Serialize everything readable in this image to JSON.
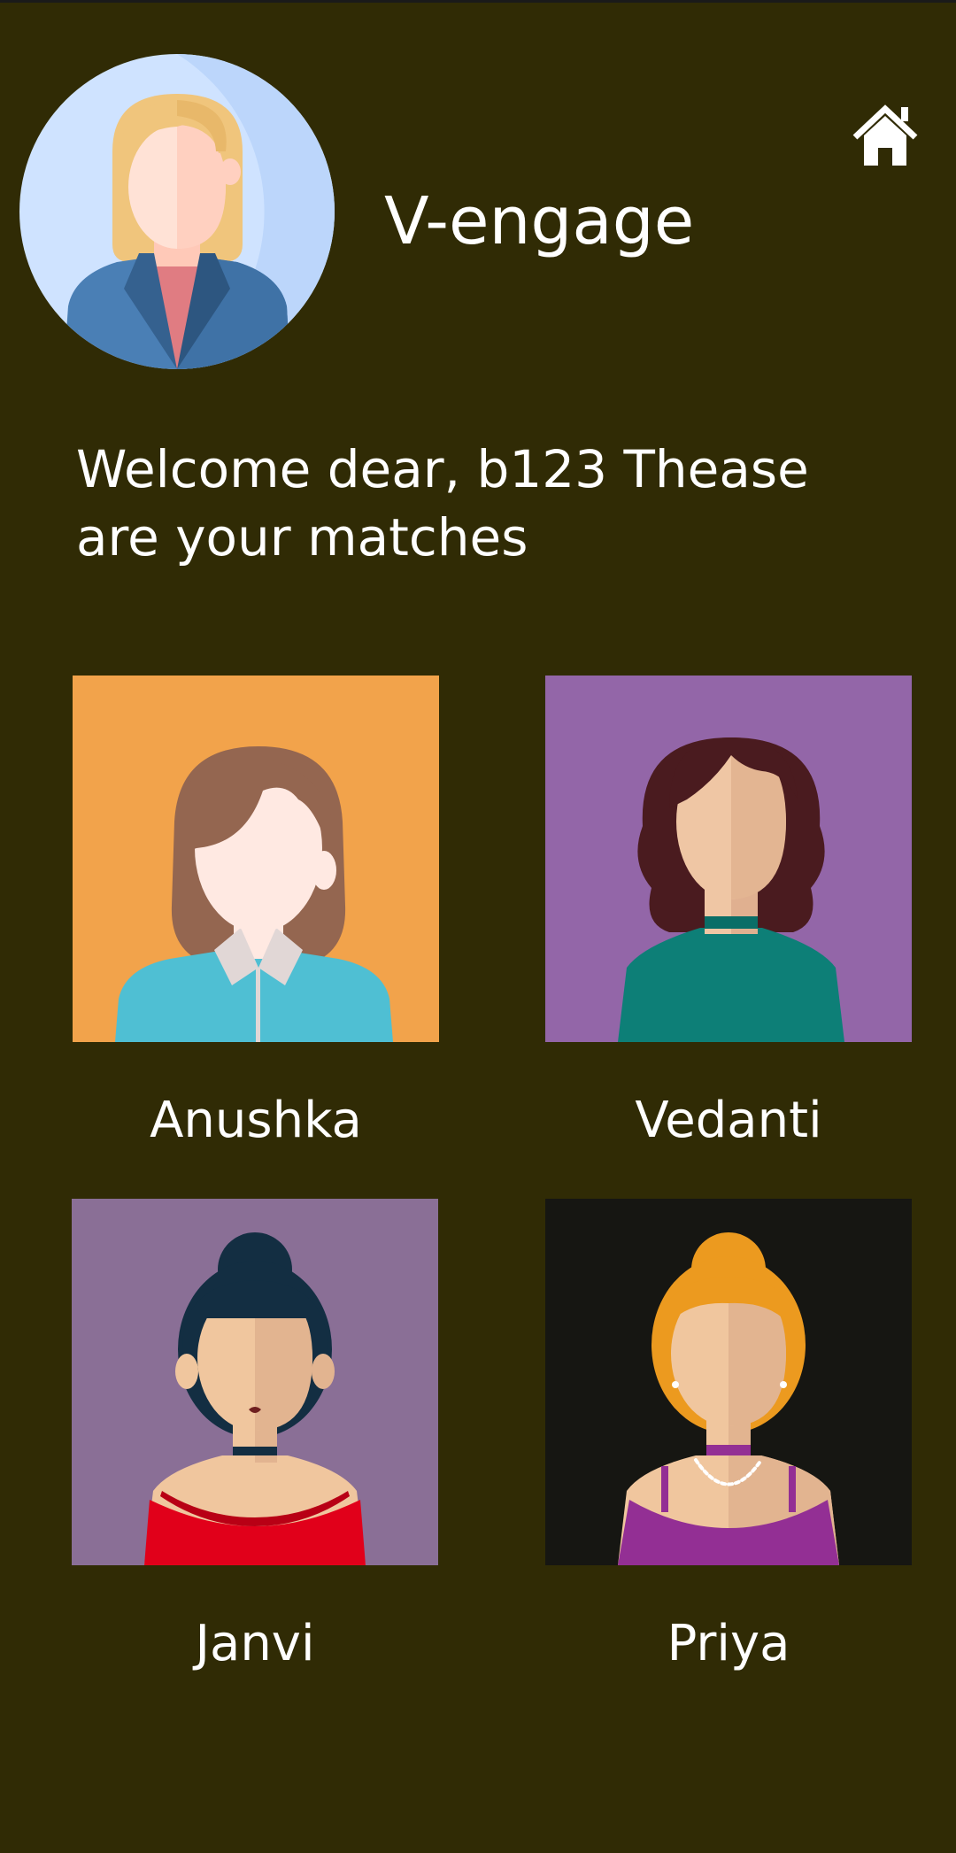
{
  "header": {
    "app_title": "V-engage",
    "profile_avatar_icon": "woman-business-avatar-icon",
    "home_icon": "home-icon"
  },
  "welcome": {
    "line1": "Welcome dear, b123 Thease",
    "line2": "are your matches"
  },
  "matches": [
    {
      "name": "Anushka",
      "avatar_bg": "#f2a34b",
      "icon": "woman-avatar-anushka-icon"
    },
    {
      "name": "Vedanti",
      "avatar_bg": "#9366a8",
      "icon": "woman-avatar-vedanti-icon"
    },
    {
      "name": "Janvi",
      "avatar_bg": "#8a6f96",
      "icon": "woman-avatar-janvi-icon"
    },
    {
      "name": "Priya",
      "avatar_bg": "#161612",
      "icon": "woman-avatar-priya-icon"
    }
  ],
  "colors": {
    "background": "#302b05",
    "text": "#ffffff"
  }
}
